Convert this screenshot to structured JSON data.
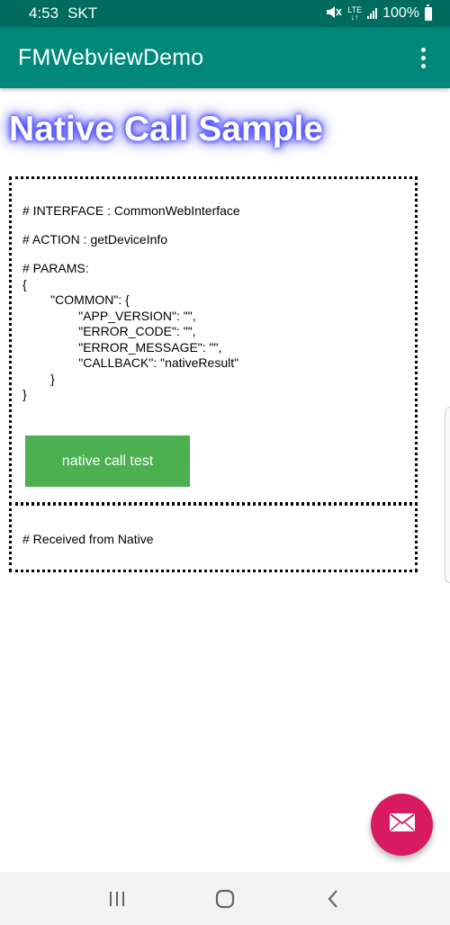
{
  "status_bar": {
    "time": "4:53",
    "carrier": "SKT",
    "network": "LTE",
    "battery": "100%"
  },
  "app_bar": {
    "title": "FMWebviewDemo",
    "menu_icon": "more-vert-icon"
  },
  "page": {
    "heading": "Native Call Sample",
    "interface_line": "# INTERFACE : CommonWebInterface",
    "action_line": "# ACTION : getDeviceInfo",
    "params_block": "# PARAMS:\n{\n        \"COMMON\": {\n                \"APP_VERSION\": \"\",\n                \"ERROR_CODE\": \"\",\n                \"ERROR_MESSAGE\": \"\",\n                \"CALLBACK\": \"nativeResult\"\n        }\n}",
    "button_label": "native call test",
    "received_label": "# Received from Native"
  },
  "fab": {
    "icon": "mail-icon",
    "color": "#d81b60"
  },
  "nav_bar": {
    "recents_icon": "recents-icon",
    "home_icon": "home-icon",
    "back_icon": "back-icon"
  },
  "colors": {
    "status_bar": "#006b5f",
    "app_bar": "#00897b",
    "button": "#4caf50"
  }
}
